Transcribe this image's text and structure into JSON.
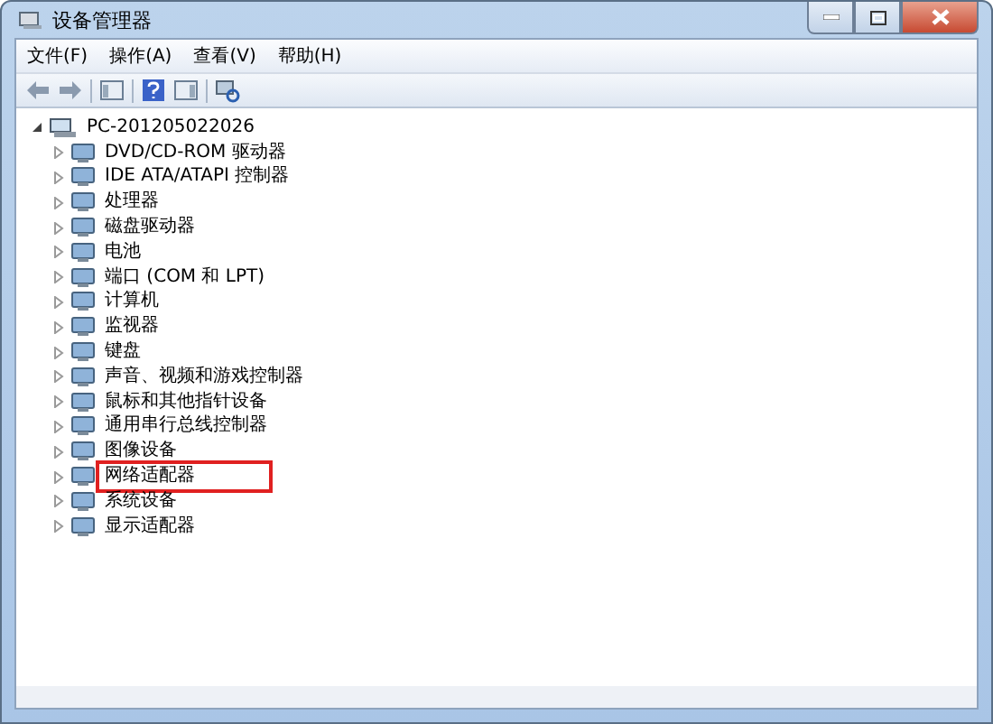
{
  "window": {
    "title": "设备管理器"
  },
  "menu": [
    "文件(F)",
    "操作(A)",
    "查看(V)",
    "帮助(H)"
  ],
  "tree": {
    "label": "PC-201205022026",
    "expanded": true,
    "children": [
      {
        "label": "DVD/CD-ROM 驱动器",
        "expanded": false,
        "highlighted": false
      },
      {
        "label": "IDE ATA/ATAPI 控制器",
        "expanded": false,
        "highlighted": false
      },
      {
        "label": "处理器",
        "expanded": false,
        "highlighted": false
      },
      {
        "label": "磁盘驱动器",
        "expanded": false,
        "highlighted": false
      },
      {
        "label": "电池",
        "expanded": false,
        "highlighted": false
      },
      {
        "label": "端口 (COM 和 LPT)",
        "expanded": false,
        "highlighted": false
      },
      {
        "label": "计算机",
        "expanded": false,
        "highlighted": false
      },
      {
        "label": "监视器",
        "expanded": false,
        "highlighted": false
      },
      {
        "label": "键盘",
        "expanded": false,
        "highlighted": false
      },
      {
        "label": "声音、视频和游戏控制器",
        "expanded": false,
        "highlighted": false
      },
      {
        "label": "鼠标和其他指针设备",
        "expanded": false,
        "highlighted": false
      },
      {
        "label": "通用串行总线控制器",
        "expanded": false,
        "highlighted": false
      },
      {
        "label": "图像设备",
        "expanded": false,
        "highlighted": false
      },
      {
        "label": "网络适配器",
        "expanded": false,
        "highlighted": true
      },
      {
        "label": "系统设备",
        "expanded": false,
        "highlighted": false
      },
      {
        "label": "显示适配器",
        "expanded": false,
        "highlighted": false
      }
    ]
  }
}
